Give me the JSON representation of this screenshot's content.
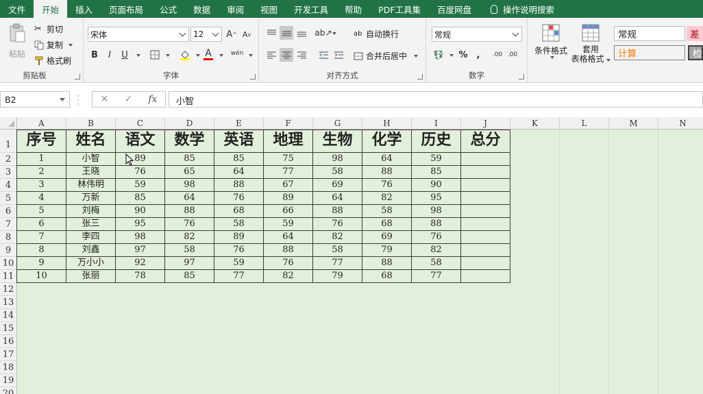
{
  "tabs": [
    "文件",
    "开始",
    "插入",
    "页面布局",
    "公式",
    "数据",
    "审阅",
    "视图",
    "开发工具",
    "帮助",
    "PDF工具集",
    "百度网盘",
    "操作说明搜索"
  ],
  "active_tab": "开始",
  "ribbon": {
    "clipboard": {
      "label": "剪贴板",
      "paste": "粘贴",
      "cut": "剪切",
      "copy": "复制",
      "format_painter": "格式刷"
    },
    "font": {
      "label": "字体",
      "font_name": "宋体",
      "font_size": "12",
      "bold": "B",
      "italic": "I",
      "underline": "U",
      "phonetic": "wén",
      "grow": "A",
      "shrink": "A"
    },
    "alignment": {
      "label": "对齐方式",
      "wrap": "自动换行",
      "merge": "合并后居中"
    },
    "number": {
      "label": "数字",
      "format": "常规",
      "percent": "%",
      "comma": ",",
      "inc_decimal": ".00",
      "dec_decimal": ".00"
    },
    "styles": {
      "conditional": "条件格式",
      "table_format_1": "套用",
      "table_format_2": "表格格式",
      "style_normal": "常规",
      "style_bad": "差",
      "style_calc": "计算",
      "style_check": "检"
    }
  },
  "formula_bar": {
    "name_box": "B2",
    "fx": "fx",
    "value": "小智"
  },
  "columns": [
    "A",
    "B",
    "C",
    "D",
    "E",
    "F",
    "G",
    "H",
    "I",
    "J",
    "K",
    "L",
    "M",
    "N"
  ],
  "rows": [
    "1",
    "2",
    "3",
    "4",
    "5",
    "6",
    "7",
    "8",
    "9",
    "10",
    "11",
    "12",
    "13",
    "14",
    "15",
    "16",
    "17",
    "18",
    "19",
    "20"
  ],
  "table": {
    "headers": [
      "序号",
      "姓名",
      "语文",
      "数学",
      "英语",
      "地理",
      "生物",
      "化学",
      "历史",
      "总分"
    ],
    "rows": [
      [
        "1",
        "小智",
        "89",
        "85",
        "85",
        "75",
        "98",
        "64",
        "59",
        ""
      ],
      [
        "2",
        "王晓",
        "76",
        "65",
        "64",
        "77",
        "58",
        "88",
        "85",
        ""
      ],
      [
        "3",
        "林伟明",
        "59",
        "98",
        "88",
        "67",
        "69",
        "76",
        "90",
        ""
      ],
      [
        "4",
        "万新",
        "85",
        "64",
        "76",
        "89",
        "64",
        "82",
        "95",
        ""
      ],
      [
        "5",
        "刘梅",
        "90",
        "88",
        "68",
        "66",
        "88",
        "58",
        "98",
        ""
      ],
      [
        "6",
        "张三",
        "95",
        "76",
        "58",
        "59",
        "76",
        "68",
        "88",
        ""
      ],
      [
        "7",
        "李四",
        "98",
        "82",
        "89",
        "64",
        "82",
        "69",
        "76",
        ""
      ],
      [
        "8",
        "刘鑫",
        "97",
        "58",
        "76",
        "88",
        "58",
        "79",
        "82",
        ""
      ],
      [
        "9",
        "万小小",
        "92",
        "97",
        "59",
        "76",
        "77",
        "88",
        "58",
        ""
      ],
      [
        "10",
        "张丽",
        "78",
        "85",
        "77",
        "82",
        "79",
        "68",
        "77",
        ""
      ]
    ]
  },
  "colors": {
    "brand": "#217346",
    "sheet_fill": "#e2efda",
    "style_bad": "#ffc7ce",
    "style_calc": "#fa7d00"
  }
}
